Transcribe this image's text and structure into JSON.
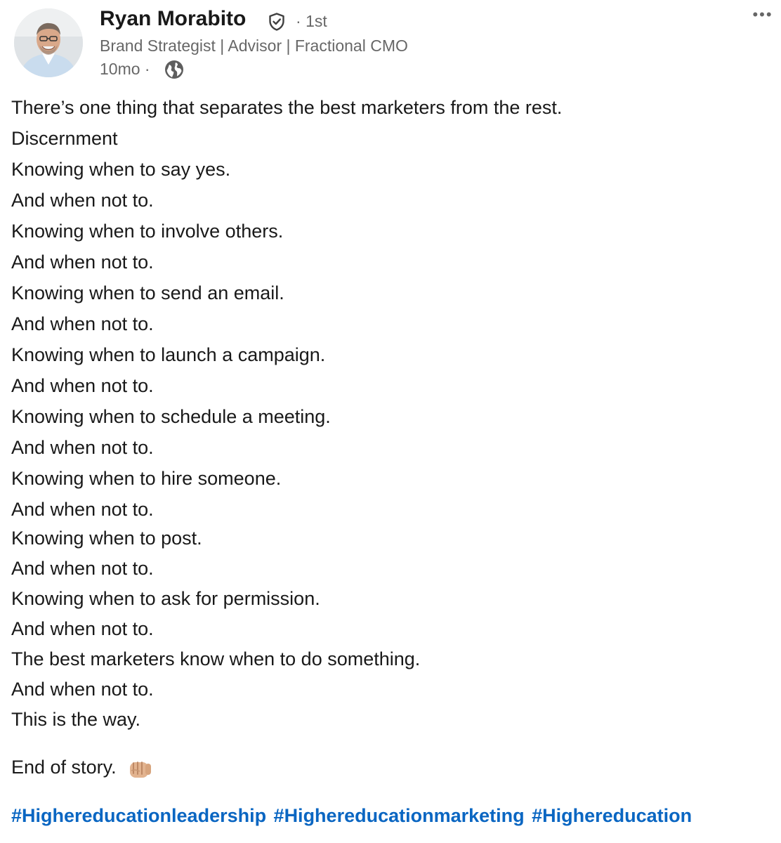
{
  "author": {
    "name": "Ryan Morabito",
    "degree": "1st",
    "headline": "Brand Strategist | Advisor | Fractional CMO",
    "time": "10mo"
  },
  "icons": {
    "avatar": "avatar-photo",
    "verified": "verified-shield-icon",
    "visibility": "globe-icon",
    "more": "more-options-icon",
    "emoji": "fist-bump-emoji"
  },
  "post": {
    "lines": [
      "There’s one thing that separates the best marketers from the rest.",
      "Discernment",
      "Knowing when to say yes.",
      "And when not to.",
      "Knowing when to involve others.",
      "And when not to.",
      "Knowing when to send an email.",
      "And when not to.",
      "Knowing when to launch a campaign.",
      "And when not to.",
      "Knowing when to schedule a meeting.",
      "And when not to.",
      "Knowing when to hire someone.",
      "And when not to.",
      "Knowing when to post.",
      "And when not to.",
      "Knowing when to ask for permission.",
      "And when not to.",
      "The best marketers know when to do something.",
      "And when not to.",
      "This is the way."
    ],
    "closing": "End of story."
  },
  "hashtags": [
    "#Highereducationleadership",
    "#Highereducationmarketing",
    "#Highereducation"
  ],
  "colors": {
    "link": "#0a66c2",
    "text": "#191919",
    "secondary": "#666666"
  }
}
